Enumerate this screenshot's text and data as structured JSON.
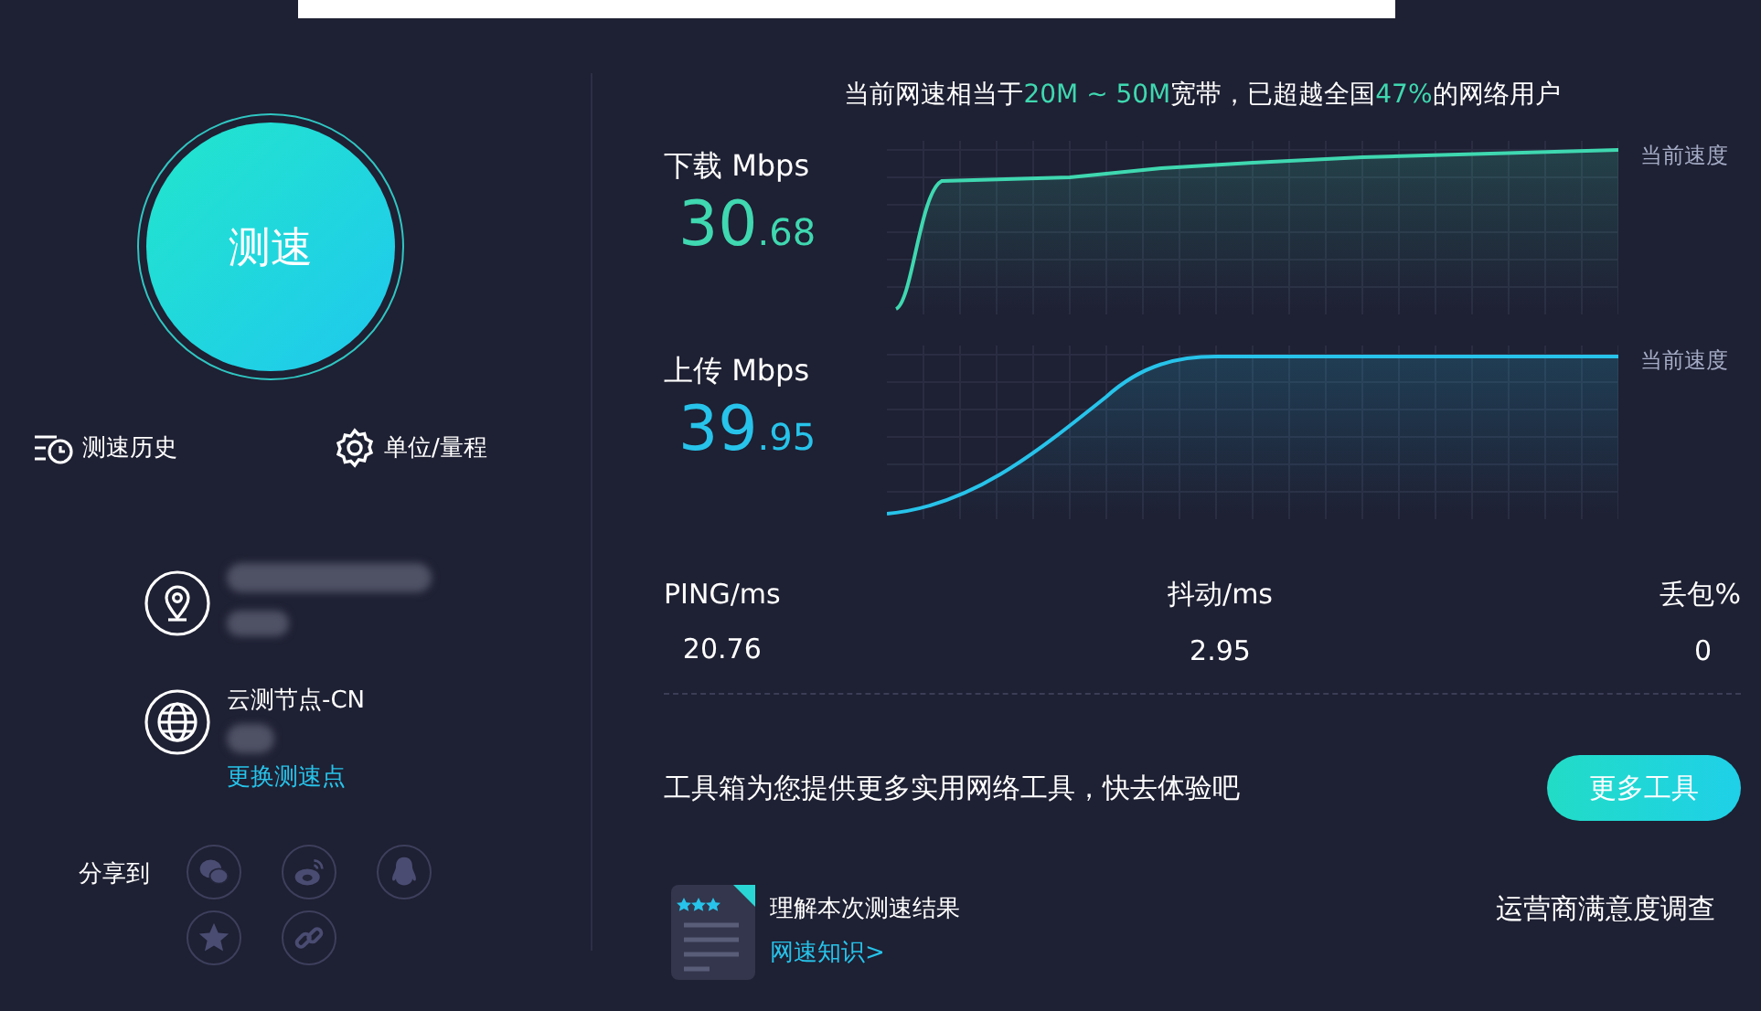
{
  "speed_button": {
    "label": "测速"
  },
  "left_actions": [
    {
      "kind": "history",
      "label": "测速历史"
    },
    {
      "kind": "settings",
      "label": "单位/量程"
    }
  ],
  "server": {
    "name": "云测节点-CN",
    "change_link": "更换测速点"
  },
  "share": {
    "label": "分享到",
    "targets": [
      {
        "kind": "wechat"
      },
      {
        "kind": "weibo"
      },
      {
        "kind": "qq"
      },
      {
        "kind": "qzone"
      },
      {
        "kind": "link"
      }
    ]
  },
  "summary_parts": [
    {
      "text": "当前网速相当于",
      "highlight": false
    },
    {
      "text": "20M ~ 50M",
      "highlight": true
    },
    {
      "text": "宽带，已超越全国",
      "highlight": false
    },
    {
      "text": "47%",
      "highlight": true
    },
    {
      "text": "的网络用户",
      "highlight": false
    }
  ],
  "speeds": [
    {
      "kind": "download",
      "label": "下载 Mbps",
      "integer": "30",
      "decimal": ".68",
      "curve_label": "当前速度"
    },
    {
      "kind": "upload",
      "label": "上传 Mbps",
      "integer": "39",
      "decimal": ".95",
      "curve_label": "当前速度"
    }
  ],
  "metrics": [
    {
      "label": "PING/ms",
      "value": "20.76"
    },
    {
      "label": "抖动/ms",
      "value": "2.95"
    },
    {
      "label": "丢包%",
      "value": "0"
    }
  ],
  "tools": {
    "text": "工具箱为您提供更多实用网络工具，快去体验吧",
    "button": "更多工具"
  },
  "knowledge": {
    "title": "理解本次测速结果",
    "link": "网速知识>"
  },
  "survey": {
    "label": "运营商满意度调查"
  }
}
